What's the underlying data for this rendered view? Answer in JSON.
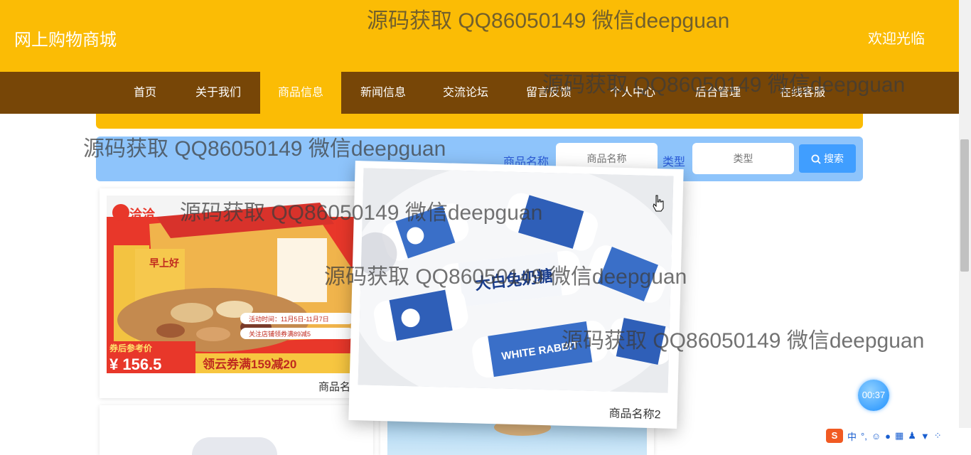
{
  "header": {
    "site_title": "网上购物商城",
    "welcome": "欢迎光临"
  },
  "nav": {
    "items": [
      {
        "label": "首页"
      },
      {
        "label": "关于我们"
      },
      {
        "label": "商品信息"
      },
      {
        "label": "新闻信息"
      },
      {
        "label": "交流论坛"
      },
      {
        "label": "留言反馈"
      },
      {
        "label": "个人中心"
      },
      {
        "label": "后台管理"
      },
      {
        "label": "在线客服"
      }
    ],
    "active": "商品信息"
  },
  "search": {
    "name_label": "商品名称",
    "name_placeholder": "商品名称",
    "type_label": "类型",
    "type_placeholder": "类型",
    "button_label": "搜索"
  },
  "products": [
    {
      "name": "商品名称",
      "image": "mixed-nuts-snack-box"
    },
    {
      "name": "商品名称2",
      "image": "white-rabbit-candy"
    }
  ],
  "snack_image_text": {
    "brand": "洽洽",
    "box_title": "早上好",
    "promo1": "活动时间：11月5日-11月7日",
    "promo2": "关注店铺领券满89减5",
    "price_label": "券后参考价",
    "price": "¥ 156.5",
    "coupon": "领云券满159减20"
  },
  "candy_image_text": {
    "cn": "大白兔奶糖",
    "en": "WHITE RABBIT"
  },
  "watermark": "源码获取 QQ86050149 微信deepguan",
  "timer": "00:37",
  "ime": {
    "lang": "中"
  },
  "colors": {
    "header": "#fbbc05",
    "nav": "#774607",
    "search_bg": "#8ec4fb",
    "button": "#409eff"
  }
}
